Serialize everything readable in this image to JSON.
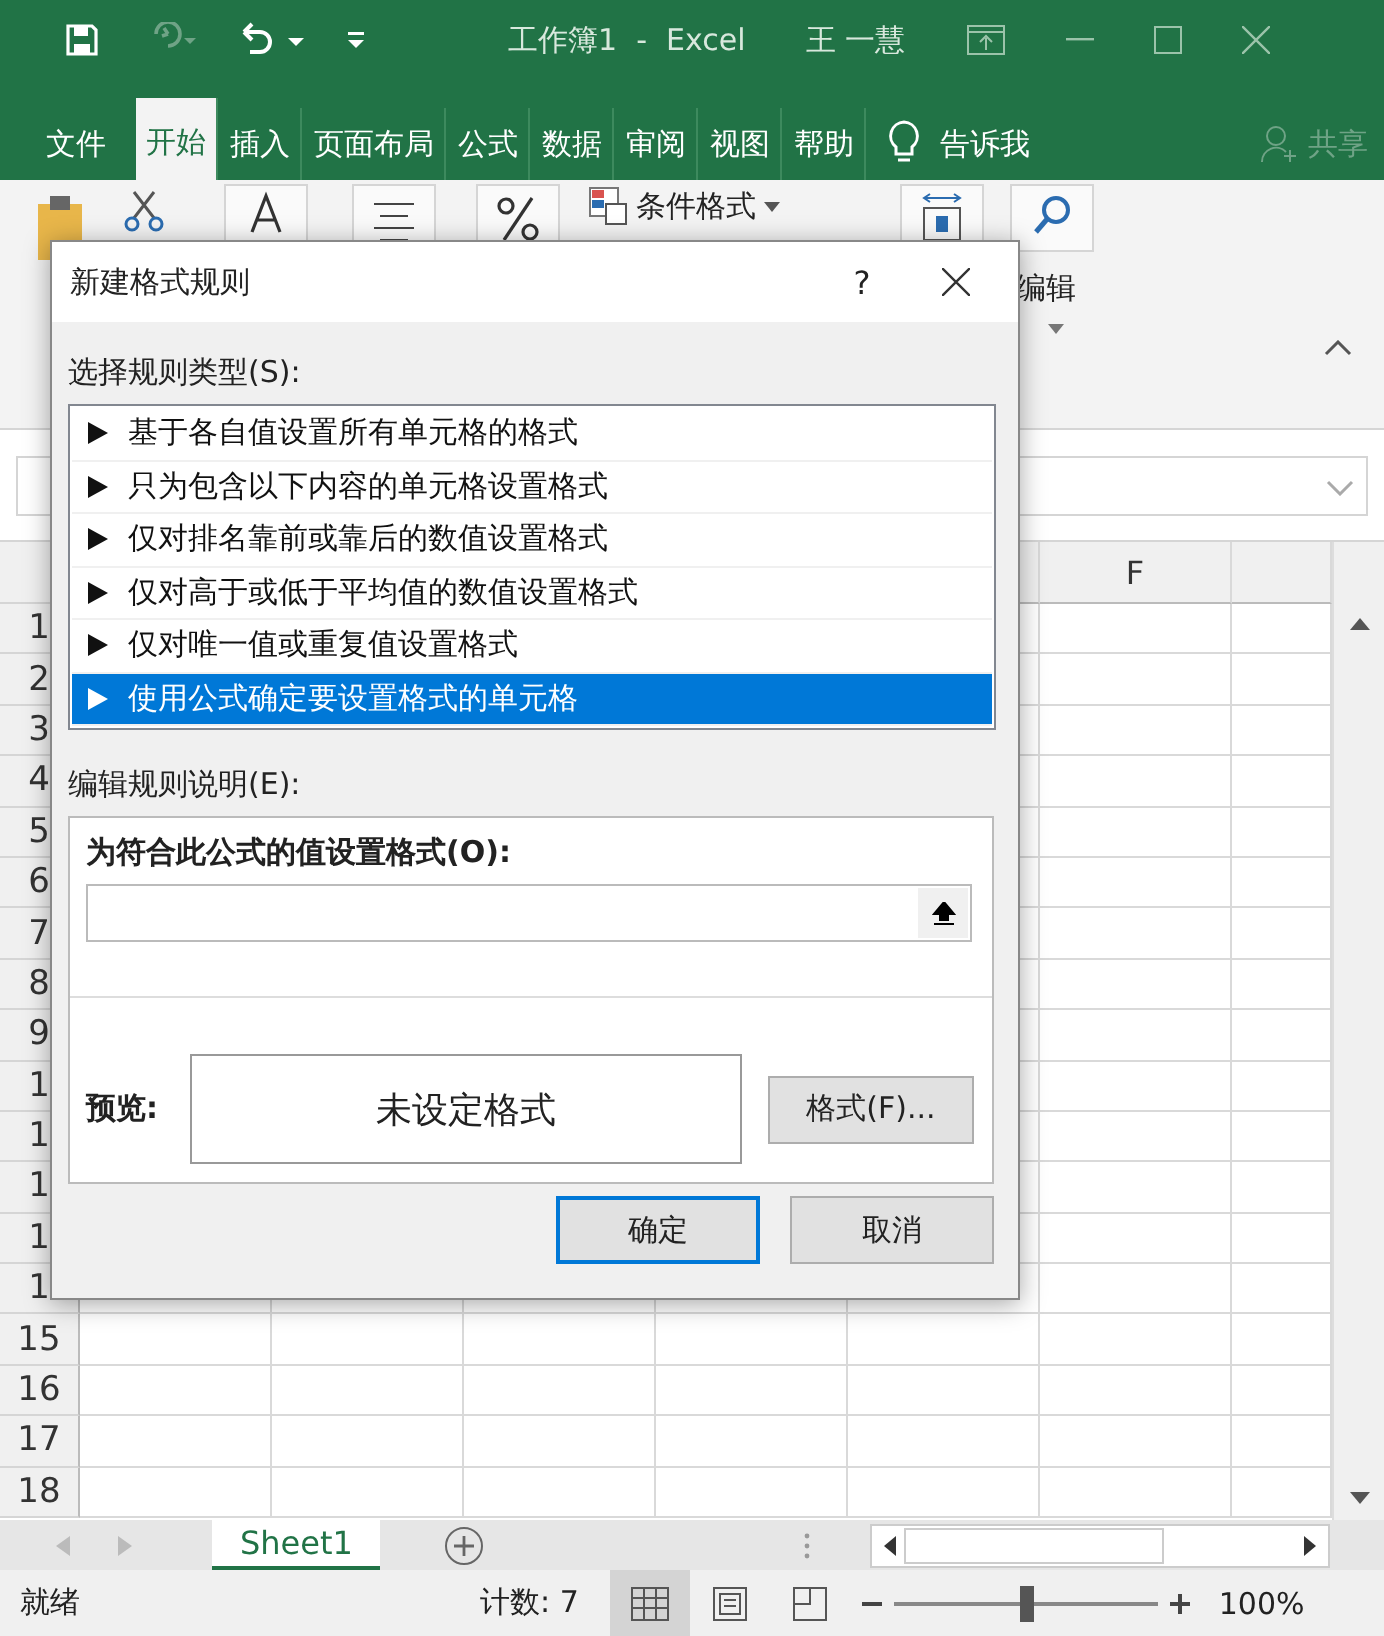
{
  "window": {
    "title": "工作簿1  -  Excel",
    "user": "王 一慧"
  },
  "quick_access": [
    {
      "kind": "save",
      "disabled": false
    },
    {
      "kind": "redo",
      "disabled": true
    },
    {
      "kind": "undo",
      "disabled": false
    },
    {
      "kind": "customize",
      "disabled": false
    }
  ],
  "ribbon_tabs": [
    {
      "label": "文件",
      "selected": false
    },
    {
      "label": "开始",
      "selected": true
    },
    {
      "label": "插入",
      "selected": false
    },
    {
      "label": "页面布局",
      "selected": false
    },
    {
      "label": "公式",
      "selected": false
    },
    {
      "label": "数据",
      "selected": false
    },
    {
      "label": "审阅",
      "selected": false
    },
    {
      "label": "视图",
      "selected": false
    },
    {
      "label": "帮助",
      "selected": false
    }
  ],
  "tell_me": "告诉我",
  "share": {
    "label": "共享",
    "disabled": true
  },
  "ribbon": {
    "conditional_format": "条件格式",
    "editing": "编辑"
  },
  "columns": [
    "F"
  ],
  "rows": [
    "1",
    "2",
    "3",
    "4",
    "5",
    "6",
    "7",
    "8",
    "9",
    "1",
    "1",
    "1",
    "1",
    "1",
    "15",
    "16",
    "17",
    "18"
  ],
  "sheet_tabs": [
    {
      "label": "Sheet1",
      "selected": true
    }
  ],
  "status_bar": {
    "ready": "就绪",
    "count": "计数: 7",
    "views": [
      {
        "kind": "normal",
        "selected": true
      },
      {
        "kind": "page_layout",
        "selected": false
      },
      {
        "kind": "page_break",
        "selected": false
      }
    ],
    "zoom": {
      "level": 0.5,
      "reading": "100%"
    }
  },
  "dialog": {
    "title": "新建格式规则",
    "help": "?",
    "rule_type_label": "选择规则类型(S):",
    "rule_types": [
      {
        "label": "基于各自值设置所有单元格的格式",
        "selected": false
      },
      {
        "label": "只为包含以下内容的单元格设置格式",
        "selected": false
      },
      {
        "label": "仅对排名靠前或靠后的数值设置格式",
        "selected": false
      },
      {
        "label": "仅对高于或低于平均值的数值设置格式",
        "selected": false
      },
      {
        "label": "仅对唯一值或重复值设置格式",
        "selected": false
      },
      {
        "label": "使用公式确定要设置格式的单元格",
        "selected": true
      }
    ],
    "description_label": "编辑规则说明(E):",
    "formula_label": "为符合此公式的值设置格式(O):",
    "preview_label": "预览:",
    "preview_text": "未设定格式",
    "format_button": "格式(F)...",
    "buttons": [
      {
        "label": "确定",
        "default": true
      },
      {
        "label": "取消",
        "default": false
      }
    ]
  }
}
